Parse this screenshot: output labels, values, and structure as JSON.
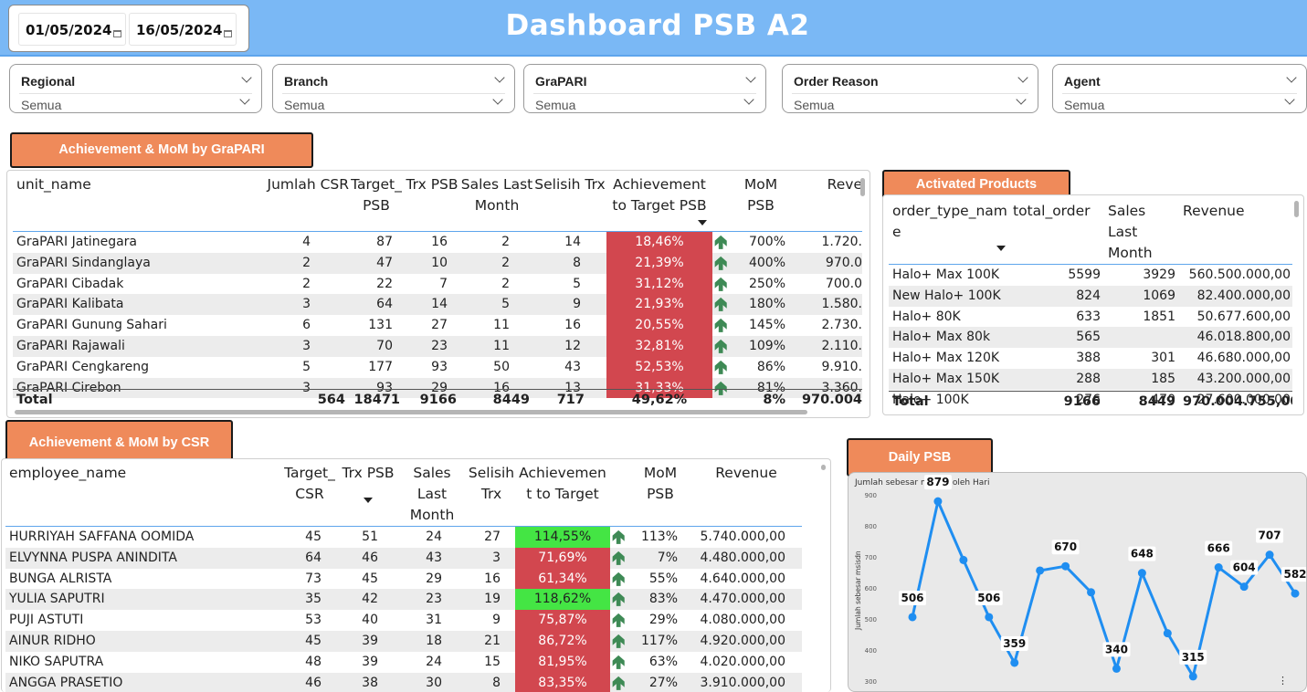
{
  "header": {
    "title": "Dashboard PSB A2",
    "date_from": "01/05/2024",
    "date_to": "16/05/2024"
  },
  "slicers": [
    {
      "title": "Regional",
      "value": "Semua"
    },
    {
      "title": "Branch",
      "value": "Semua"
    },
    {
      "title": "GraPARI",
      "value": "Semua"
    },
    {
      "title": "Order Reason",
      "value": "Semua"
    },
    {
      "title": "Agent",
      "value": "Semua"
    }
  ],
  "grapari_table": {
    "title": "Achievement & MoM by GraPARI",
    "columns": [
      "unit_name",
      "Jumlah CSR",
      "Target_ PSB",
      "Trx PSB",
      "Sales Last Month",
      "Selisih Trx",
      "Achievement to Target PSB",
      "MoM PSB",
      "Reve"
    ],
    "rows": [
      {
        "unit_name": "GraPARI Jatinegara",
        "csr": "4",
        "target": "87",
        "trx": "16",
        "sales_last": "2",
        "selisih": "14",
        "achievement": "18,46%",
        "mom": "700%",
        "revenue": "1.720."
      },
      {
        "unit_name": "GraPARI Sindanglaya",
        "csr": "2",
        "target": "47",
        "trx": "10",
        "sales_last": "2",
        "selisih": "8",
        "achievement": "21,39%",
        "mom": "400%",
        "revenue": "970.0"
      },
      {
        "unit_name": "GraPARI Cibadak",
        "csr": "2",
        "target": "22",
        "trx": "7",
        "sales_last": "2",
        "selisih": "5",
        "achievement": "31,12%",
        "mom": "250%",
        "revenue": "700.0"
      },
      {
        "unit_name": "GraPARI Kalibata",
        "csr": "3",
        "target": "64",
        "trx": "14",
        "sales_last": "5",
        "selisih": "9",
        "achievement": "21,93%",
        "mom": "180%",
        "revenue": "1.580."
      },
      {
        "unit_name": "GraPARI Gunung Sahari",
        "csr": "6",
        "target": "131",
        "trx": "27",
        "sales_last": "11",
        "selisih": "16",
        "achievement": "20,55%",
        "mom": "145%",
        "revenue": "2.730."
      },
      {
        "unit_name": "GraPARI Rajawali",
        "csr": "3",
        "target": "70",
        "trx": "23",
        "sales_last": "11",
        "selisih": "12",
        "achievement": "32,81%",
        "mom": "109%",
        "revenue": "2.110."
      },
      {
        "unit_name": "GraPARI Cengkareng",
        "csr": "5",
        "target": "177",
        "trx": "93",
        "sales_last": "50",
        "selisih": "43",
        "achievement": "52,53%",
        "mom": "86%",
        "revenue": "9.910."
      },
      {
        "unit_name": "GraPARI Cirebon",
        "csr": "3",
        "target": "93",
        "trx": "29",
        "sales_last": "16",
        "selisih": "13",
        "achievement": "31,33%",
        "mom": "81%",
        "revenue": "3.360."
      }
    ],
    "total": {
      "label": "Total",
      "csr": "564",
      "target": "18471",
      "trx": "9166",
      "sales_last": "8449",
      "selisih": "717",
      "achievement": "49,62%",
      "mom": "8%",
      "revenue": "970.004"
    }
  },
  "products_table": {
    "title": "Activated Products",
    "columns": [
      "order_type_nam e",
      "total_order",
      "Sales Last Month",
      "Revenue"
    ],
    "rows": [
      {
        "name": "Halo+ Max 100K",
        "total": "5599",
        "sales_last": "3929",
        "revenue": "560.500.000,00"
      },
      {
        "name": "New Halo+ 100K",
        "total": "824",
        "sales_last": "1069",
        "revenue": "82.400.000,00"
      },
      {
        "name": "Halo+ 80K",
        "total": "633",
        "sales_last": "1851",
        "revenue": "50.677.600,00"
      },
      {
        "name": "Halo+ Max 80k",
        "total": "565",
        "sales_last": "",
        "revenue": "46.018.800,00"
      },
      {
        "name": "Halo+ Max 120K",
        "total": "388",
        "sales_last": "301",
        "revenue": "46.680.000,00"
      },
      {
        "name": "Halo+ Max 150K",
        "total": "288",
        "sales_last": "185",
        "revenue": "43.200.000,00"
      },
      {
        "name": "Halo+ 100K",
        "total": "276",
        "sales_last": "470",
        "revenue": "27.600.000,00"
      }
    ],
    "total": {
      "label": "Total",
      "total": "9166",
      "sales_last": "8449",
      "revenue": "970.004.755,00"
    }
  },
  "csr_table": {
    "title": "Achievement & MoM by CSR",
    "columns": [
      "employee_name",
      "Target_ CSR",
      "Trx PSB",
      "Sales Last Month",
      "Selisih Trx",
      "Achievemen t to Target",
      "MoM PSB",
      "Revenue"
    ],
    "rows": [
      {
        "name": "HURRIYAH SAFFANA OOMIDA",
        "target": "45",
        "trx": "51",
        "sales_last": "24",
        "selisih": "27",
        "achievement": "114,55%",
        "ach_color": "green",
        "mom": "113%",
        "revenue": "5.740.000,00"
      },
      {
        "name": "ELVYNNA PUSPA ANINDITA",
        "target": "64",
        "trx": "46",
        "sales_last": "43",
        "selisih": "3",
        "achievement": "71,69%",
        "ach_color": "red",
        "mom": "7%",
        "revenue": "4.480.000,00"
      },
      {
        "name": "BUNGA ALRISTA",
        "target": "73",
        "trx": "45",
        "sales_last": "29",
        "selisih": "16",
        "achievement": "61,34%",
        "ach_color": "red",
        "mom": "55%",
        "revenue": "4.640.000,00"
      },
      {
        "name": "YULIA SAPUTRI",
        "target": "35",
        "trx": "42",
        "sales_last": "23",
        "selisih": "19",
        "achievement": "118,62%",
        "ach_color": "green",
        "mom": "83%",
        "revenue": "4.470.000,00"
      },
      {
        "name": "PUJI ASTUTI",
        "target": "53",
        "trx": "40",
        "sales_last": "31",
        "selisih": "9",
        "achievement": "75,87%",
        "ach_color": "red",
        "mom": "29%",
        "revenue": "4.080.000,00"
      },
      {
        "name": "AINUR RIDHO",
        "target": "45",
        "trx": "39",
        "sales_last": "18",
        "selisih": "21",
        "achievement": "86,72%",
        "ach_color": "red",
        "mom": "117%",
        "revenue": "4.920.000,00"
      },
      {
        "name": "NIKO SAPUTRA",
        "target": "48",
        "trx": "39",
        "sales_last": "24",
        "selisih": "15",
        "achievement": "81,95%",
        "ach_color": "red",
        "mom": "63%",
        "revenue": "4.020.000,00"
      },
      {
        "name": "ANGGA PRASETIO",
        "target": "46",
        "trx": "38",
        "sales_last": "30",
        "selisih": "8",
        "achievement": "83,35%",
        "ach_color": "red",
        "mom": "27%",
        "revenue": "3.910.000,00"
      }
    ]
  },
  "daily_chart": {
    "title": "Daily PSB",
    "chart_data": {
      "type": "line",
      "title": "Jumlah sebesar msisdn oleh Hari",
      "ylabel": "Jumlah sebesar msisdn",
      "xlabel": "",
      "yticks": [
        900,
        800,
        700,
        600,
        500,
        400,
        300
      ],
      "ylim": [
        300,
        900
      ],
      "grid": false,
      "series": [
        {
          "values": [
            506,
            879,
            690,
            506,
            359,
            656,
            670,
            586,
            340,
            648,
            454,
            315,
            666,
            604,
            707,
            582
          ]
        }
      ],
      "data_labels": [
        "506",
        "879",
        "",
        "506",
        "359",
        "",
        "670",
        "",
        "340",
        "648",
        "",
        "315",
        "666",
        "604",
        "707",
        "582"
      ],
      "line_color": "#1f8ef1"
    }
  },
  "colors": {
    "header_bg": "#7ab8f5",
    "tab_orange": "#ef8a5a",
    "achievement_red": "#d2474f",
    "achievement_green": "#44e544",
    "mom_arrow": "#3e8a55"
  },
  "icons": {
    "mom_up": "up-arrow-icon",
    "calendar": "calendar-icon",
    "dropdown": "chevron-down-icon"
  }
}
